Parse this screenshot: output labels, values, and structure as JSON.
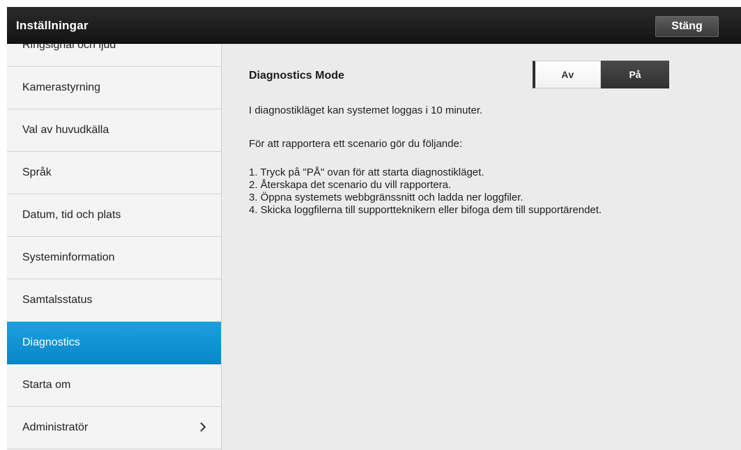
{
  "window": {
    "title": "Inställningar",
    "close_label": "Stäng"
  },
  "sidebar": {
    "items": [
      {
        "label": "Ringsignal och ljud",
        "active": false
      },
      {
        "label": "Kamerastyrning",
        "active": false
      },
      {
        "label": "Val av huvudkälla",
        "active": false
      },
      {
        "label": "Språk",
        "active": false
      },
      {
        "label": "Datum, tid och plats",
        "active": false
      },
      {
        "label": "Systeminformation",
        "active": false
      },
      {
        "label": "Samtalsstatus",
        "active": false
      },
      {
        "label": "Diagnostics",
        "active": true
      },
      {
        "label": "Starta om",
        "active": false
      },
      {
        "label": "Administratör",
        "active": false,
        "icon": "chevron-right-icon"
      }
    ]
  },
  "main": {
    "mode_title": "Diagnostics Mode",
    "toggle": {
      "off_label": "Av",
      "on_label": "På",
      "selected": "Av"
    },
    "intro": "I diagnostikläget kan systemet loggas i 10 minuter.",
    "report_heading": "För att rapportera ett scenario gör du följande:",
    "steps": [
      "1. Tryck på \"PÅ\" ovan för att starta diagnostikläget.",
      "2. Återskapa det scenario du vill rapportera.",
      "3. Öppna systemets webbgränssnitt och ladda ner loggfiler.",
      "4. Skicka loggfilerna till supportteknikern eller bifoga dem till supportärendet."
    ]
  },
  "colors": {
    "accent": "#0f8fd1",
    "titlebar": "#1a1a1a",
    "background": "#ebebeb"
  }
}
